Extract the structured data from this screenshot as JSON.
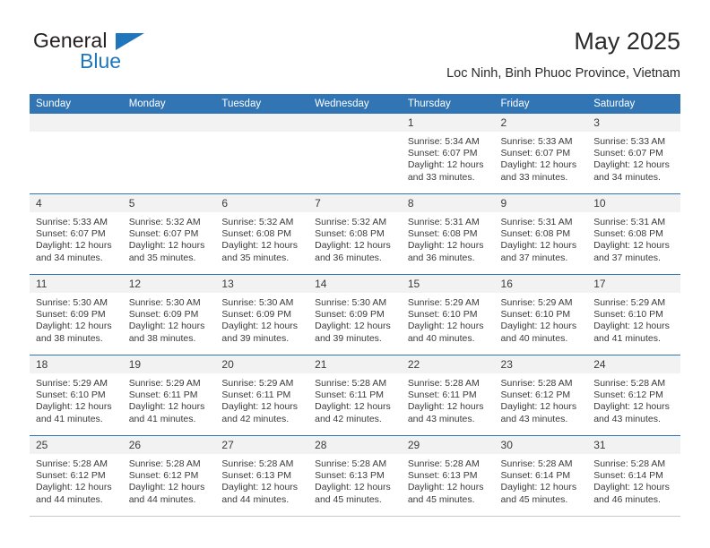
{
  "brand": {
    "name_part1": "General",
    "name_part2": "Blue",
    "triangle_color": "#1f76bc"
  },
  "header": {
    "title": "May 2025",
    "subtitle": "Loc Ninh, Binh Phuoc Province, Vietnam"
  },
  "colors": {
    "header_blue": "#3175b4",
    "daynum_band": "#f2f2f2",
    "text": "#3a3a3a"
  },
  "weekdays": [
    "Sunday",
    "Monday",
    "Tuesday",
    "Wednesday",
    "Thursday",
    "Friday",
    "Saturday"
  ],
  "labels": {
    "sunrise_prefix": "Sunrise:",
    "sunset_prefix": "Sunset:",
    "daylight_prefix": "Daylight:"
  },
  "weeks": [
    [
      {
        "day": "",
        "empty": true
      },
      {
        "day": "",
        "empty": true
      },
      {
        "day": "",
        "empty": true
      },
      {
        "day": "",
        "empty": true
      },
      {
        "day": "1",
        "sunrise": "Sunrise: 5:34 AM",
        "sunset": "Sunset: 6:07 PM",
        "daylight_line1": "Daylight: 12 hours",
        "daylight_line2": "and 33 minutes."
      },
      {
        "day": "2",
        "sunrise": "Sunrise: 5:33 AM",
        "sunset": "Sunset: 6:07 PM",
        "daylight_line1": "Daylight: 12 hours",
        "daylight_line2": "and 33 minutes."
      },
      {
        "day": "3",
        "sunrise": "Sunrise: 5:33 AM",
        "sunset": "Sunset: 6:07 PM",
        "daylight_line1": "Daylight: 12 hours",
        "daylight_line2": "and 34 minutes."
      }
    ],
    [
      {
        "day": "4",
        "sunrise": "Sunrise: 5:33 AM",
        "sunset": "Sunset: 6:07 PM",
        "daylight_line1": "Daylight: 12 hours",
        "daylight_line2": "and 34 minutes."
      },
      {
        "day": "5",
        "sunrise": "Sunrise: 5:32 AM",
        "sunset": "Sunset: 6:07 PM",
        "daylight_line1": "Daylight: 12 hours",
        "daylight_line2": "and 35 minutes."
      },
      {
        "day": "6",
        "sunrise": "Sunrise: 5:32 AM",
        "sunset": "Sunset: 6:08 PM",
        "daylight_line1": "Daylight: 12 hours",
        "daylight_line2": "and 35 minutes."
      },
      {
        "day": "7",
        "sunrise": "Sunrise: 5:32 AM",
        "sunset": "Sunset: 6:08 PM",
        "daylight_line1": "Daylight: 12 hours",
        "daylight_line2": "and 36 minutes."
      },
      {
        "day": "8",
        "sunrise": "Sunrise: 5:31 AM",
        "sunset": "Sunset: 6:08 PM",
        "daylight_line1": "Daylight: 12 hours",
        "daylight_line2": "and 36 minutes."
      },
      {
        "day": "9",
        "sunrise": "Sunrise: 5:31 AM",
        "sunset": "Sunset: 6:08 PM",
        "daylight_line1": "Daylight: 12 hours",
        "daylight_line2": "and 37 minutes."
      },
      {
        "day": "10",
        "sunrise": "Sunrise: 5:31 AM",
        "sunset": "Sunset: 6:08 PM",
        "daylight_line1": "Daylight: 12 hours",
        "daylight_line2": "and 37 minutes."
      }
    ],
    [
      {
        "day": "11",
        "sunrise": "Sunrise: 5:30 AM",
        "sunset": "Sunset: 6:09 PM",
        "daylight_line1": "Daylight: 12 hours",
        "daylight_line2": "and 38 minutes."
      },
      {
        "day": "12",
        "sunrise": "Sunrise: 5:30 AM",
        "sunset": "Sunset: 6:09 PM",
        "daylight_line1": "Daylight: 12 hours",
        "daylight_line2": "and 38 minutes."
      },
      {
        "day": "13",
        "sunrise": "Sunrise: 5:30 AM",
        "sunset": "Sunset: 6:09 PM",
        "daylight_line1": "Daylight: 12 hours",
        "daylight_line2": "and 39 minutes."
      },
      {
        "day": "14",
        "sunrise": "Sunrise: 5:30 AM",
        "sunset": "Sunset: 6:09 PM",
        "daylight_line1": "Daylight: 12 hours",
        "daylight_line2": "and 39 minutes."
      },
      {
        "day": "15",
        "sunrise": "Sunrise: 5:29 AM",
        "sunset": "Sunset: 6:10 PM",
        "daylight_line1": "Daylight: 12 hours",
        "daylight_line2": "and 40 minutes."
      },
      {
        "day": "16",
        "sunrise": "Sunrise: 5:29 AM",
        "sunset": "Sunset: 6:10 PM",
        "daylight_line1": "Daylight: 12 hours",
        "daylight_line2": "and 40 minutes."
      },
      {
        "day": "17",
        "sunrise": "Sunrise: 5:29 AM",
        "sunset": "Sunset: 6:10 PM",
        "daylight_line1": "Daylight: 12 hours",
        "daylight_line2": "and 41 minutes."
      }
    ],
    [
      {
        "day": "18",
        "sunrise": "Sunrise: 5:29 AM",
        "sunset": "Sunset: 6:10 PM",
        "daylight_line1": "Daylight: 12 hours",
        "daylight_line2": "and 41 minutes."
      },
      {
        "day": "19",
        "sunrise": "Sunrise: 5:29 AM",
        "sunset": "Sunset: 6:11 PM",
        "daylight_line1": "Daylight: 12 hours",
        "daylight_line2": "and 41 minutes."
      },
      {
        "day": "20",
        "sunrise": "Sunrise: 5:29 AM",
        "sunset": "Sunset: 6:11 PM",
        "daylight_line1": "Daylight: 12 hours",
        "daylight_line2": "and 42 minutes."
      },
      {
        "day": "21",
        "sunrise": "Sunrise: 5:28 AM",
        "sunset": "Sunset: 6:11 PM",
        "daylight_line1": "Daylight: 12 hours",
        "daylight_line2": "and 42 minutes."
      },
      {
        "day": "22",
        "sunrise": "Sunrise: 5:28 AM",
        "sunset": "Sunset: 6:11 PM",
        "daylight_line1": "Daylight: 12 hours",
        "daylight_line2": "and 43 minutes."
      },
      {
        "day": "23",
        "sunrise": "Sunrise: 5:28 AM",
        "sunset": "Sunset: 6:12 PM",
        "daylight_line1": "Daylight: 12 hours",
        "daylight_line2": "and 43 minutes."
      },
      {
        "day": "24",
        "sunrise": "Sunrise: 5:28 AM",
        "sunset": "Sunset: 6:12 PM",
        "daylight_line1": "Daylight: 12 hours",
        "daylight_line2": "and 43 minutes."
      }
    ],
    [
      {
        "day": "25",
        "sunrise": "Sunrise: 5:28 AM",
        "sunset": "Sunset: 6:12 PM",
        "daylight_line1": "Daylight: 12 hours",
        "daylight_line2": "and 44 minutes."
      },
      {
        "day": "26",
        "sunrise": "Sunrise: 5:28 AM",
        "sunset": "Sunset: 6:12 PM",
        "daylight_line1": "Daylight: 12 hours",
        "daylight_line2": "and 44 minutes."
      },
      {
        "day": "27",
        "sunrise": "Sunrise: 5:28 AM",
        "sunset": "Sunset: 6:13 PM",
        "daylight_line1": "Daylight: 12 hours",
        "daylight_line2": "and 44 minutes."
      },
      {
        "day": "28",
        "sunrise": "Sunrise: 5:28 AM",
        "sunset": "Sunset: 6:13 PM",
        "daylight_line1": "Daylight: 12 hours",
        "daylight_line2": "and 45 minutes."
      },
      {
        "day": "29",
        "sunrise": "Sunrise: 5:28 AM",
        "sunset": "Sunset: 6:13 PM",
        "daylight_line1": "Daylight: 12 hours",
        "daylight_line2": "and 45 minutes."
      },
      {
        "day": "30",
        "sunrise": "Sunrise: 5:28 AM",
        "sunset": "Sunset: 6:14 PM",
        "daylight_line1": "Daylight: 12 hours",
        "daylight_line2": "and 45 minutes."
      },
      {
        "day": "31",
        "sunrise": "Sunrise: 5:28 AM",
        "sunset": "Sunset: 6:14 PM",
        "daylight_line1": "Daylight: 12 hours",
        "daylight_line2": "and 46 minutes."
      }
    ]
  ]
}
